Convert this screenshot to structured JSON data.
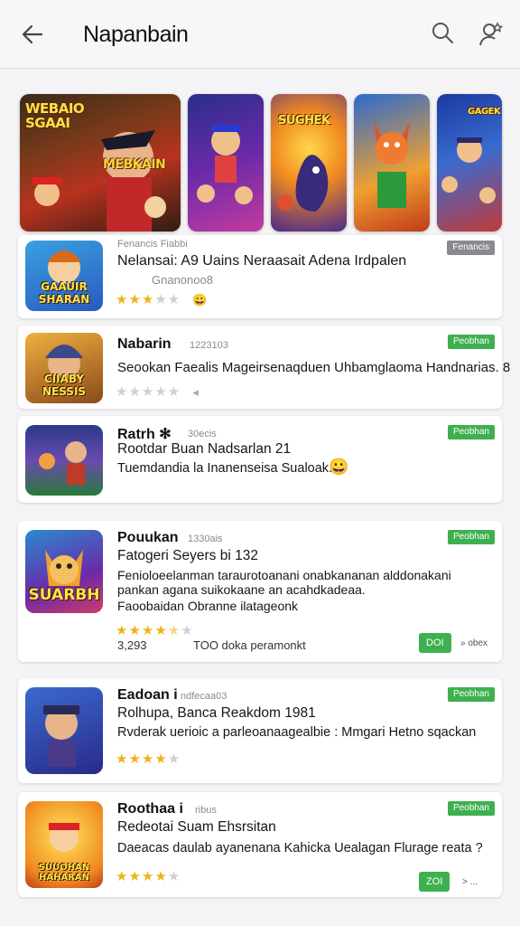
{
  "header": {
    "title": "Napanbain",
    "back_icon": "arrow-left-icon",
    "search_icon": "search-icon",
    "profile_icon": "person-star-icon"
  },
  "banners": [
    {
      "label": "WEBAIO SGAAI",
      "sub": "MEBKAIN"
    },
    {
      "label": ""
    },
    {
      "label": "SUGHEK"
    },
    {
      "label": ""
    },
    {
      "label": "GAGEK"
    }
  ],
  "apps": [
    {
      "icon_label": "GAAUIR SHARAN",
      "category": "Fenancis Fiabbi",
      "title": "Nelansai: A9 Uains Neraasait Adena Irdpalen",
      "meta": "Gnanonoo8",
      "rating": 3,
      "badge": "Fenancis",
      "badge_gray": true
    },
    {
      "icon_label": "CIIABY NESSIS",
      "name": "Nabarin",
      "meta_small": "1223103",
      "description": "Seookan Faealis Mageirsenaqduen Uhbamglaoma Handnarias. 8",
      "rating": 0,
      "badge": "Peobhan"
    },
    {
      "icon_label": "",
      "name": "Ratrh ✻",
      "meta_small": "30ecis",
      "subtitle": "Rootdar Buan Nadsarlan 21",
      "description": "Tuemdandia la Inanenseisa Sualoak.",
      "badge": "Peobhan"
    },
    {
      "icon_label": "SUARBH",
      "name": "Pouukan",
      "meta_small": "1330ais",
      "subtitle": "Fatogeri Seyers bi  132",
      "desc1": "Fenioloeelanman taraurotoanani onabkananan alddonakani",
      "desc2": "pankan agana suikokaane an acahdkadeaa.",
      "desc3": "Faoobaidan Obranne ilatageonk",
      "rating": 4.5,
      "installs": "3,293",
      "developer": "TOO  doka peramonkt",
      "badge": "Peobhan",
      "get_label": "DOI",
      "get_extra": "» obex"
    },
    {
      "icon_label": "",
      "name": "Eadoan i",
      "meta_small": "ndfecaa03",
      "subtitle": "Rolhupa, Banca Reakdom 1981",
      "description": "Rvderak uerioic a parleoanaagealbie : Mmgari Hetno sqackan",
      "rating": 4,
      "badge": "Peobhan"
    },
    {
      "icon_label": "SUUOHAN HAHARAN",
      "name": "Roothaa i",
      "meta_small": "ribus",
      "subtitle": "Redeotai Suam Ehsrsitan",
      "description": "Daeacas daulab ayanenana Kahicka Uealagan Flurage reata ?",
      "rating": 4,
      "badge": "Peobhan",
      "get_label": "ZOI",
      "get_extra": "> ..."
    }
  ],
  "colors": {
    "accent_green": "#3fb050",
    "star": "#f0b21a",
    "background": "#f4f4f6"
  }
}
